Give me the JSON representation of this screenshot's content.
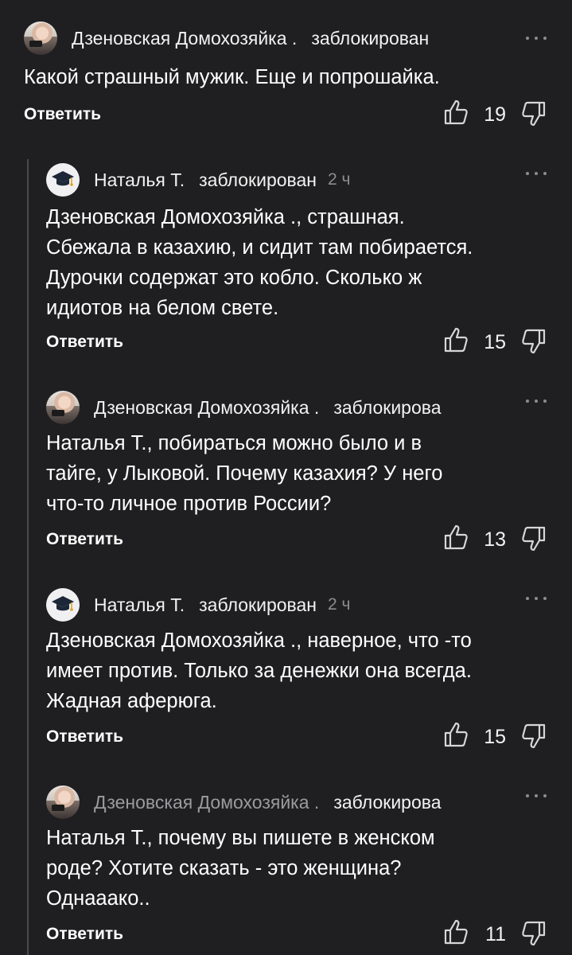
{
  "comments": [
    {
      "author": "Дзеновская Домохозяйка .",
      "status": "заблокирован",
      "time": "",
      "text": "Какой страшный мужик. Еще и попрошайка.",
      "reply_label": "Ответить",
      "likes": "19",
      "avatar": "photo-avatar"
    },
    {
      "author": "Наталья Т.",
      "status": "заблокирован",
      "time": "2 ч",
      "text": "Дзеновская Домохозяйка ., страшная.\nСбежала в казахию, и сидит там побирается.\nДурочки содержат это кобло. Сколько ж\nидиотов на белом свете.",
      "reply_label": "Ответить",
      "likes": "15",
      "avatar": "graduation-cap-avatar"
    },
    {
      "author": "Дзеновская Домохозяйка .",
      "status": "заблокирова",
      "time": "",
      "text": "Наталья Т., побираться можно было и в\nтайге, у Лыковой. Почему казахия? У него\nчто-то личное против России?",
      "reply_label": "Ответить",
      "likes": "13",
      "avatar": "photo-avatar"
    },
    {
      "author": "Наталья Т.",
      "status": "заблокирован",
      "time": "2 ч",
      "text": "Дзеновская Домохозяйка ., наверное, что -то\nимеет против. Только за денежки она всегда.\nЖадная аферюга.",
      "reply_label": "Ответить",
      "likes": "15",
      "avatar": "graduation-cap-avatar"
    },
    {
      "author": "Дзеновская Домохозяйка .",
      "status": "заблокирова",
      "time": "",
      "text": "Наталья Т., почему вы пишете в женском\nроде? Хотите сказать - это женщина?\nОднааако..",
      "reply_label": "Ответить",
      "likes": "11",
      "avatar": "photo-avatar"
    }
  ],
  "colors": {
    "background": "#1f1f21",
    "text": "#ffffff",
    "muted": "#8c8c90",
    "thread_line": "#4a4a4d"
  }
}
